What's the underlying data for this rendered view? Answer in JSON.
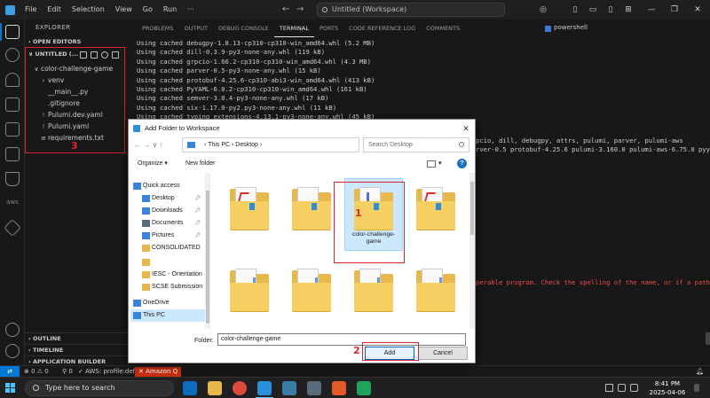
{
  "titlebar": {
    "menus": [
      "File",
      "Edit",
      "Selection",
      "View",
      "Go",
      "Run",
      "···"
    ],
    "command_center": "Untitled (Workspace)"
  },
  "sidebar": {
    "title": "EXPLORER",
    "open_editors": "OPEN EDITORS",
    "workspace": "UNTITLED (...",
    "tree": [
      {
        "label": "color-challenge-game",
        "glyph": "∨",
        "indent": 1
      },
      {
        "label": "venv",
        "glyph": "›",
        "indent": 2
      },
      {
        "label": "__main__.py",
        "glyph": "",
        "indent": 2
      },
      {
        "label": ".gitignore",
        "glyph": "",
        "indent": 2
      },
      {
        "label": "Pulumi.dev.yaml",
        "glyph": "!",
        "indent": 2
      },
      {
        "label": "Pulumi.yaml",
        "glyph": "!",
        "indent": 2
      },
      {
        "label": "requirements.txt",
        "glyph": "≡",
        "indent": 2
      }
    ],
    "outline": "OUTLINE",
    "timeline": "TIMELINE",
    "app_builder": "APPLICATION BUILDER"
  },
  "annotations": {
    "label1": "1",
    "label2": "2",
    "label3": "3",
    "color": "#d9232d"
  },
  "panel": {
    "tabs": [
      "PROBLEMS",
      "OUTPUT",
      "DEBUG CONSOLE",
      "TERMINAL",
      "PORTS",
      "CODE REFERENCE LOG",
      "COMMENTS"
    ],
    "active_tab": "TERMINAL",
    "shell": "powershell",
    "lines": [
      "Using cached debugpy-1.8.13-cp310-cp310-win_amd64.whl (5.2 MB)",
      "Using cached dill-0.3.9-py3-none-any.whl (119 kB)",
      "Using cached grpcio-1.66.2-cp310-cp310-win_amd64.whl (4.3 MB)",
      "Using cached parver-0.5-py3-none-any.whl (15 kB)",
      "Using cached protobuf-4.25.6-cp310-abi3-win_amd64.whl (413 kB)",
      "Using cached PyYAML-6.0.2-cp310-cp310-win_amd64.whl (161 kB)",
      "Using cached semver-3.0.4-py3-none-any.whl (17 kB)",
      "Using cached six-1.17.0-py2.py3-none-any.whl (11 kB)",
      "Using cached typing_extensions-4.13.1-py3-none-any.whl (45 kB)"
    ],
    "side_line_1": "pcio, dill, debugpy, attrs, pulumi, parver, pulumi-aws",
    "side_line_2": "rver-0.5 protobuf-4.25.6 pulumi-3.160.0 pulumi-aws-6.75.0 pyya",
    "error_line": "perable program. Check the spelling of the name, or if a path"
  },
  "statusbar": {
    "remote": "⇄",
    "problems": "⊗ 0  ⚠ 0",
    "ports": "⚲ 0",
    "aws": "AWS: profile:default",
    "amazon_q": "Amazon Q"
  },
  "taskbar": {
    "search_placeholder": "Type here to search",
    "time": "8:41 PM",
    "date": "2025-04-06"
  },
  "dialog": {
    "title": "Add Folder to Workspace",
    "close": "✕",
    "nav": "←  →  ∨  ↑",
    "breadcrumb": "›  This PC  ›  Desktop  ›",
    "search_placeholder": "Search Desktop",
    "organize": "Organize ▾",
    "new_folder": "New folder",
    "view_arrow": "▾",
    "help": "?",
    "nav_items": [
      {
        "label": "Quick access",
        "pin": false,
        "color": "#3a84d9"
      },
      {
        "label": "Desktop",
        "pin": true,
        "color": "#3a84d9"
      },
      {
        "label": "Downloads",
        "pin": true,
        "color": "#3a84d9"
      },
      {
        "label": "Documents",
        "pin": true,
        "color": "#5a6b7a"
      },
      {
        "label": "Pictures",
        "pin": true,
        "color": "#3a84d9"
      },
      {
        "label": "CONSOLIDATED",
        "pin": false,
        "color": "#e8b94a"
      },
      {
        "label": "",
        "pin": false,
        "color": "#e8b94a"
      },
      {
        "label": "IESC - Orientation",
        "pin": false,
        "color": "#e8b94a"
      },
      {
        "label": "SCSE Submission",
        "pin": false,
        "color": "#e8b94a"
      },
      {
        "label": "",
        "pin": false,
        "color": "#ffffff"
      },
      {
        "label": "OneDrive",
        "pin": false,
        "color": "#3a84d9"
      },
      {
        "label": "This PC",
        "pin": false,
        "color": "#3a84d9",
        "selected": true
      }
    ],
    "selected_folder": "color-challenge-game",
    "folder_field_label": "Folder:",
    "folder_value": "color-challenge-game",
    "add": "Add",
    "cancel": "Cancel"
  }
}
